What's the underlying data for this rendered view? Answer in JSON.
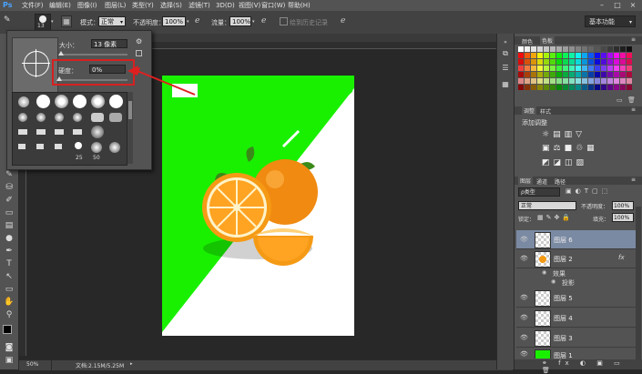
{
  "app": {
    "logo": "Ps"
  },
  "menu": [
    "文件(F)",
    "编辑(E)",
    "图像(I)",
    "图层(L)",
    "类型(Y)",
    "选择(S)",
    "滤镜(T)",
    "3D(D)",
    "视图(V)",
    "窗口(W)",
    "帮助(H)"
  ],
  "window_controls": [
    "–",
    "□",
    "×"
  ],
  "options": {
    "brush_size": "13",
    "mode_label": "模式：",
    "mode_value": "正常",
    "opacity_label": "不透明度：",
    "opacity_value": "100%",
    "flow_label": "流量：",
    "flow_value": "100%",
    "history_label": "绘到历史记录",
    "workspace": "基本功能"
  },
  "brush_panel": {
    "size_label": "大小：",
    "size_value": "13 像素",
    "hardness_label": "硬度：",
    "hardness_value": "0%",
    "tip_numbers": [
      "25",
      "50"
    ]
  },
  "canvas": {
    "background": "#ffffff",
    "green": "#19f000"
  },
  "status": {
    "zoom": "50%",
    "doc": "文档:2.15M/5.25M"
  },
  "right": {
    "color_tabs": [
      "颜色",
      "色板"
    ],
    "adjust_tabs": [
      "调整",
      "样式"
    ],
    "adjust_title": "添加调整",
    "layer_tabs": [
      "图层",
      "通道",
      "路径"
    ],
    "kind_label": "ρ类型",
    "blend_mode": "正常",
    "opacity_label": "不透明度：",
    "opacity_value": "100%",
    "lock_label": "锁定：",
    "fill_label": "填充：",
    "fill_value": "100%",
    "fx": "fx",
    "effects_label": "效果",
    "shadow_label": "投影",
    "layers": [
      "图层 6",
      "图层 2",
      "图层 5",
      "图层 4",
      "图层 3",
      "图层 1"
    ]
  }
}
